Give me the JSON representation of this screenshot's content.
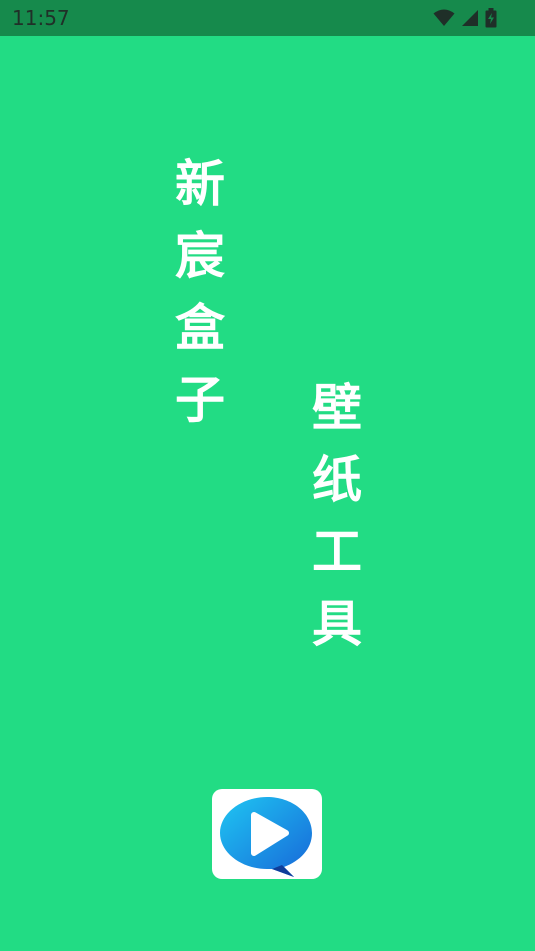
{
  "status_bar": {
    "time": "11:57",
    "icons": [
      "wifi-icon",
      "signal-icon",
      "battery-charging-icon"
    ],
    "background": "#168a4c"
  },
  "splash": {
    "background": "#22dc84",
    "title_line_1": "新宸盒子",
    "title_line_2": "壁纸工具",
    "text_color": "#ffffff",
    "logo": {
      "icon": "play-bubble-logo-icon",
      "accent_start": "#1fb8f0",
      "accent_end": "#1766d8"
    }
  }
}
